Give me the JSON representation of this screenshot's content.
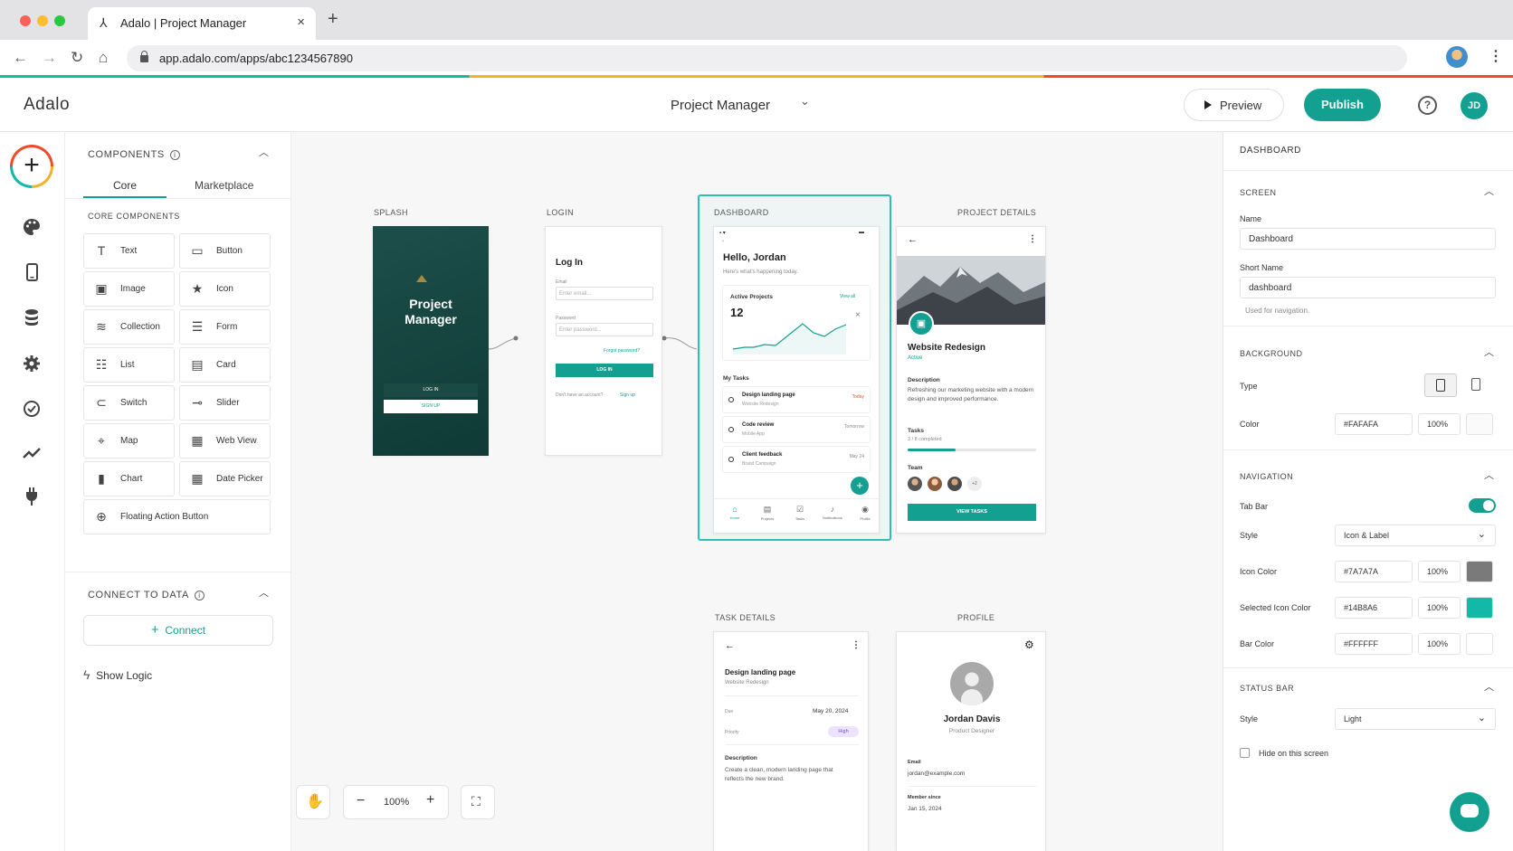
{
  "browser": {
    "tab_title": "Adalo | Project Manager",
    "url": "app.adalo.com/apps/abc1234567890",
    "tab_close": "×",
    "new_tab": "+"
  },
  "app": {
    "logo": "Adalo",
    "project_name": "Project Manager",
    "preview_label": "Preview",
    "publish_label": "Publish",
    "user_initials": "JD",
    "help": "?"
  },
  "rail": {
    "add": "+",
    "icons": [
      "palette-icon",
      "phone-icon",
      "database-icon",
      "gear-icon",
      "check-circle-icon",
      "analytics-icon",
      "plug-icon"
    ]
  },
  "components": {
    "title": "COMPONENTS",
    "tabs": [
      "Core",
      "Marketplace"
    ],
    "section": "CORE COMPONENTS",
    "items": [
      {
        "label": "Text",
        "icon": "T"
      },
      {
        "label": "Button",
        "icon": "▭"
      },
      {
        "label": "Image",
        "icon": "▣"
      },
      {
        "label": "Icon",
        "icon": "★"
      },
      {
        "label": "Collection",
        "icon": "≋"
      },
      {
        "label": "Form",
        "icon": "☰"
      },
      {
        "label": "List",
        "icon": "☷"
      },
      {
        "label": "Card",
        "icon": "▤"
      },
      {
        "label": "Switch",
        "icon": "⊂"
      },
      {
        "label": "Slider",
        "icon": "⊸"
      },
      {
        "label": "Map",
        "icon": "⌖"
      },
      {
        "label": "Web View",
        "icon": "▦"
      },
      {
        "label": "Chart",
        "icon": "▮"
      },
      {
        "label": "Date Picker",
        "icon": "▦"
      },
      {
        "label": "Floating Action Button",
        "icon": "⊕"
      }
    ],
    "connect_title": "CONNECT TO DATA",
    "connect_label": "Connect",
    "show_logic": "Show Logic"
  },
  "canvas": {
    "labels": {
      "splash": "SPLASH",
      "login": "LOGIN",
      "dashboard": "DASHBOARD",
      "project_details": "PROJECT DETAILS",
      "task_details": "TASK DETAILS",
      "profile": "PROFILE"
    },
    "splash": {
      "title_line1": "Project",
      "title_line2": "Manager",
      "login_btn": "LOG IN",
      "signup_btn": "SIGN UP"
    },
    "login": {
      "title": "Log In",
      "email_label": "Email",
      "email_ph": "Enter email...",
      "password_label": "Password",
      "password_ph": "Enter password...",
      "forgot": "Forgot password?",
      "login_btn": "LOG IN",
      "no_account": "Don't have an account?",
      "signup": "Sign up"
    },
    "dashboard": {
      "greeting": "Hello, Jordan",
      "subtitle": "Here's what's happening today.",
      "active_projects_label": "Active Projects",
      "view_all": "View all",
      "active_projects_value": "12",
      "my_tasks": "My Tasks",
      "tasks": [
        {
          "name": "Design landing page",
          "project": "Website Redesign",
          "due": "Today"
        },
        {
          "name": "Code review",
          "project": "Mobile App",
          "due": "Tomorrow"
        },
        {
          "name": "Client feedback",
          "project": "Brand Campaign",
          "due": "May 24"
        }
      ],
      "nav": [
        "Home",
        "Projects",
        "Tasks",
        "Notifications",
        "Profile"
      ]
    },
    "project": {
      "name": "Website Redesign",
      "status": "Active",
      "desc_label": "Description",
      "desc": "Refreshing our marketing website with a modern design and improved performance.",
      "tasks_label": "Tasks",
      "tasks_progress": "3 / 8 completed",
      "progress": 0.375,
      "team_label": "Team",
      "team_more": "+2",
      "btn": "VIEW TASKS"
    },
    "task": {
      "title": "Design landing page",
      "project": "Website Redesign",
      "due_label": "Due",
      "due": "May 20, 2024",
      "priority_label": "Priority",
      "priority": "High",
      "desc_label": "Description",
      "desc": "Create a clean, modern landing page that reflects the new brand."
    },
    "profile": {
      "name": "Jordan Davis",
      "role": "Product Designer",
      "email_label": "Email",
      "email": "jordan@example.com",
      "member_label": "Member since",
      "member": "Jan 15, 2024"
    },
    "zoom": "100%"
  },
  "props": {
    "title": "DASHBOARD",
    "screen_section": "SCREEN",
    "name_label": "Name",
    "name_value": "Dashboard",
    "short_label": "Short Name",
    "short_value": "dashboard",
    "short_help": "Used for navigation.",
    "bg_section": "BACKGROUND",
    "type_label": "Type",
    "color_label": "Color",
    "color_value": "#FAFAFA",
    "color_opacity": "100%",
    "nav_section": "NAVIGATION",
    "tabbar_label": "Tab Bar",
    "style_label": "Style",
    "style_value": "Icon & Label",
    "icon_color_label": "Icon Color",
    "icon_color": "#7A7A7A",
    "icon_opacity": "100%",
    "sel_color_label": "Selected Icon Color",
    "sel_color": "#14B8A6",
    "sel_opacity": "100%",
    "bar_color_label": "Bar Color",
    "bar_color": "#FFFFFF",
    "bar_opacity": "100%",
    "status_section": "STATUS BAR",
    "status_style_label": "Style",
    "status_style_value": "Light",
    "hide_label": "Hide on this screen"
  }
}
